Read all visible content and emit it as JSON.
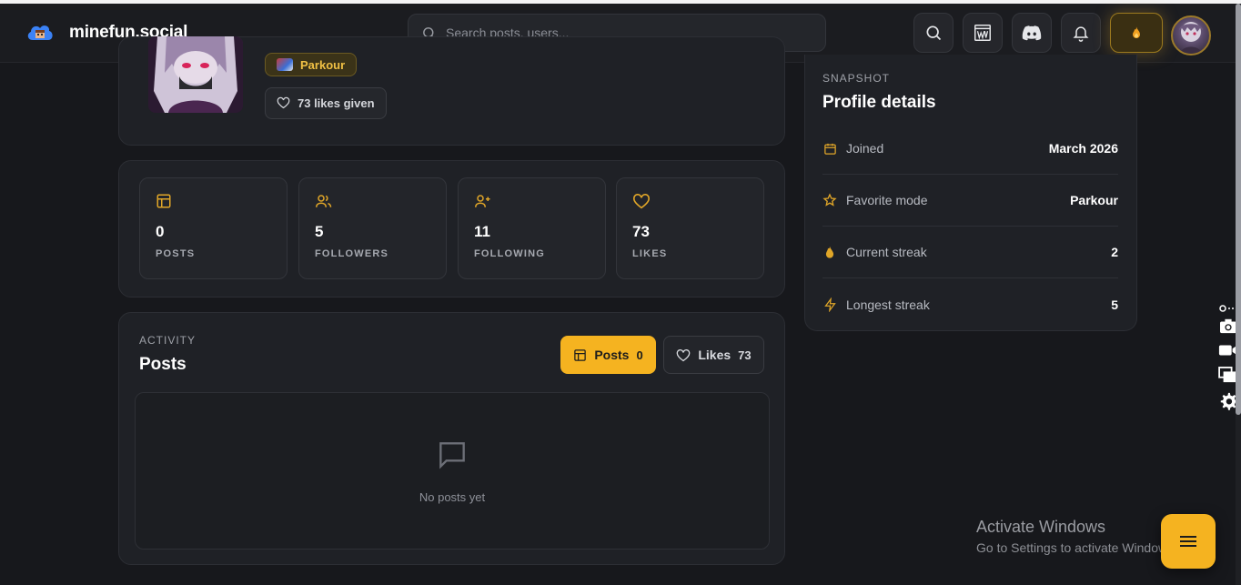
{
  "brand": {
    "name": "minefun.social"
  },
  "search": {
    "placeholder": "Search posts, users..."
  },
  "topbar": {
    "icons": [
      "search-icon",
      "wiki-icon",
      "discord-icon",
      "bell-icon",
      "streak-flame-icon"
    ]
  },
  "profile": {
    "mode_badge": "Parkour",
    "likes_given": "73 likes given"
  },
  "stats": [
    {
      "value": "0",
      "label": "POSTS",
      "icon": "posts-icon"
    },
    {
      "value": "5",
      "label": "FOLLOWERS",
      "icon": "followers-icon"
    },
    {
      "value": "11",
      "label": "FOLLOWING",
      "icon": "following-icon"
    },
    {
      "value": "73",
      "label": "LIKES",
      "icon": "heart-icon"
    }
  ],
  "activity": {
    "eyebrow": "ACTIVITY",
    "title": "Posts",
    "tabs": [
      {
        "label": "Posts",
        "count": "0",
        "active": true
      },
      {
        "label": "Likes",
        "count": "73",
        "active": false
      }
    ],
    "empty_text": "No posts yet"
  },
  "details": {
    "eyebrow": "SNAPSHOT",
    "title": "Profile details",
    "rows": [
      {
        "label": "Joined",
        "value": "March 2026",
        "icon": "calendar-icon"
      },
      {
        "label": "Favorite mode",
        "value": "Parkour",
        "icon": "star-icon"
      },
      {
        "label": "Current streak",
        "value": "2",
        "icon": "flame-icon"
      },
      {
        "label": "Longest streak",
        "value": "5",
        "icon": "bolt-icon"
      }
    ]
  },
  "watermark": {
    "title": "Activate Windows",
    "subtitle": "Go to Settings to activate Windows."
  },
  "colors": {
    "accent": "#f5b320",
    "background": "#17181c",
    "card": "#1f2126"
  }
}
